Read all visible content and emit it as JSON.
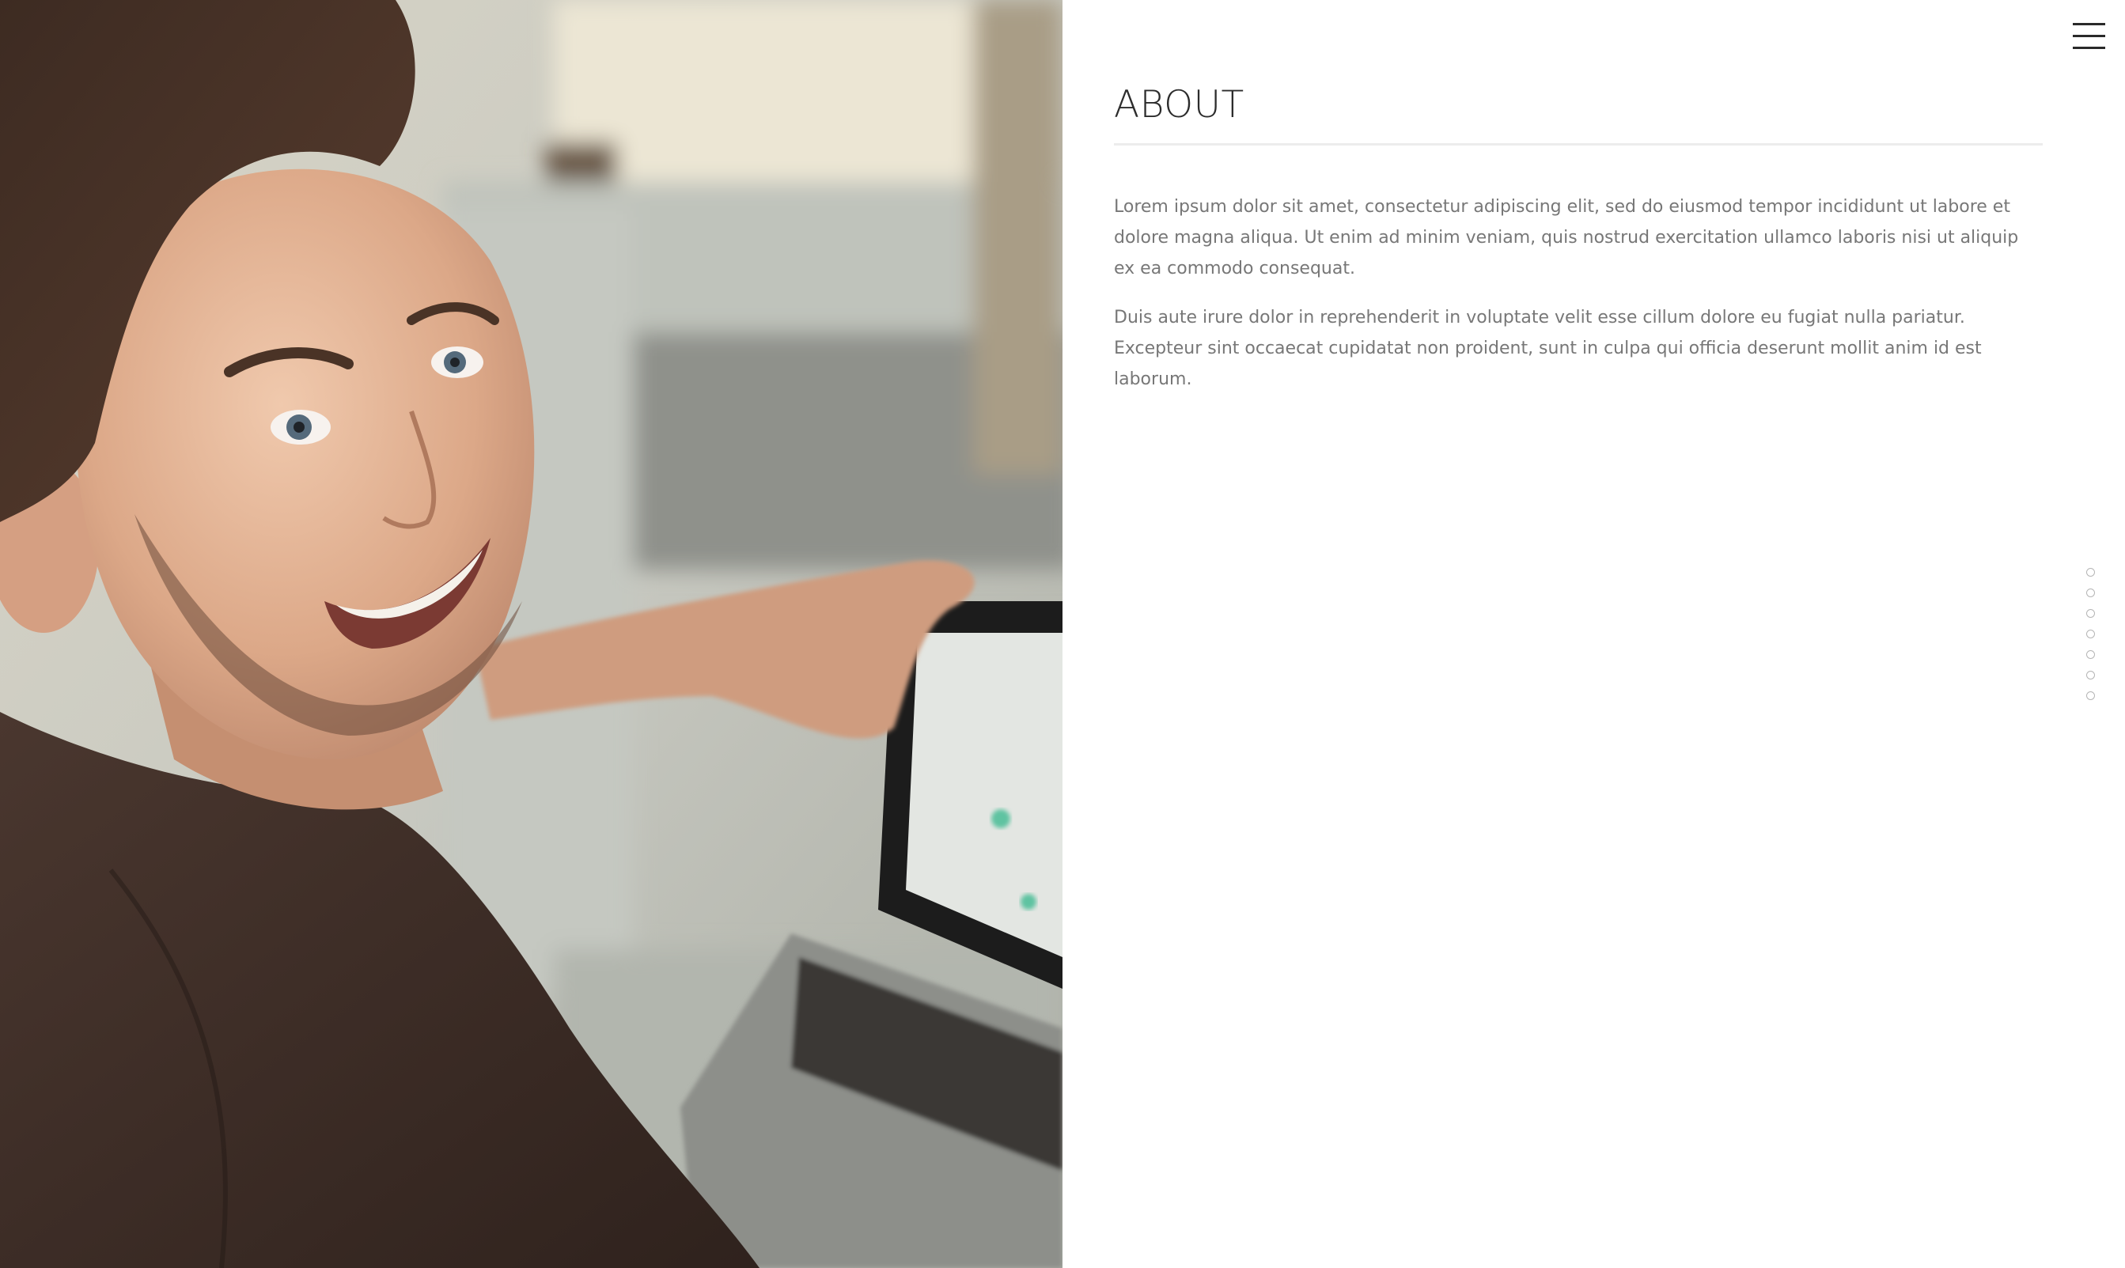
{
  "hero": {
    "image_description_icon": "portrait-photo"
  },
  "about": {
    "title": "ABOUT",
    "paragraphs": [
      "Lorem ipsum dolor sit amet, consectetur adipiscing elit, sed do eiusmod tempor incididunt ut labore et dolore magna aliqua. Ut enim ad minim veniam, quis nostrud exercitation ullamco laboris nisi ut aliquip ex ea commodo consequat.",
      "Duis aute irure dolor in reprehenderit in voluptate velit esse cillum dolore eu fugiat nulla pariatur. Excepteur sint occaecat cupidatat non proident, sunt in culpa qui officia deserunt mollit anim id est laborum."
    ]
  },
  "nav": {
    "menu_icon": "hamburger-menu-icon",
    "section_dot_count": 7
  },
  "colors": {
    "title": "#2c2c2c",
    "body_text": "#777777",
    "rule": "#ececec",
    "dot_border": "#b5b5b5"
  }
}
